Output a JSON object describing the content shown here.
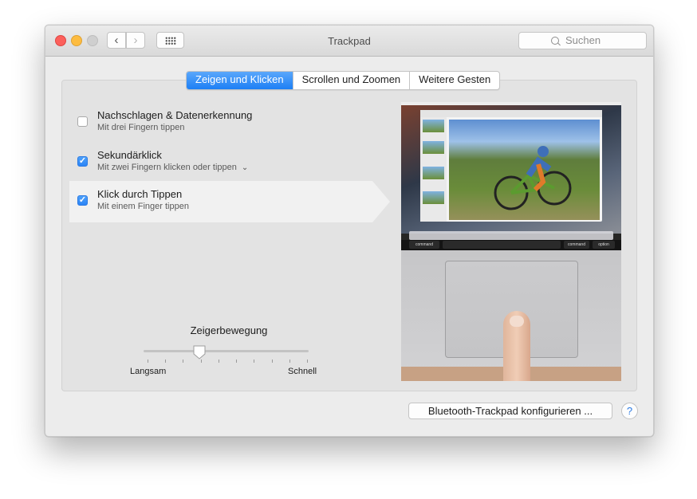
{
  "window": {
    "title": "Trackpad"
  },
  "toolbar": {
    "back_icon": "chevron-left-icon",
    "forward_icon": "chevron-right-icon",
    "show_all_icon": "grid-icon",
    "search_placeholder": "Suchen"
  },
  "tabs": [
    {
      "label": "Zeigen und Klicken",
      "active": true
    },
    {
      "label": "Scrollen und Zoomen",
      "active": false
    },
    {
      "label": "Weitere Gesten",
      "active": false
    }
  ],
  "options": [
    {
      "label": "Nachschlagen & Datenerkennung",
      "sub": "Mit drei Fingern tippen",
      "checked": false
    },
    {
      "label": "Sekundärklick",
      "sub": "Mit zwei Fingern klicken oder tippen",
      "checked": true
    },
    {
      "label": "Klick durch Tippen",
      "sub": "Mit einem Finger tippen",
      "checked": true
    }
  ],
  "tracking_speed": {
    "title": "Zeigerbewegung",
    "min_label": "Langsam",
    "max_label": "Schnell",
    "value_fraction": 0.34,
    "tick_count": 10
  },
  "preview_keys": {
    "left_command": "command",
    "right_command": "command",
    "option": "option"
  },
  "footer": {
    "bluetooth_button": "Bluetooth-Trackpad konfigurieren ...",
    "help_label": "?"
  },
  "colors": {
    "accent": "#2a84f6",
    "close": "#fc605c",
    "minimize": "#fdbc40"
  }
}
